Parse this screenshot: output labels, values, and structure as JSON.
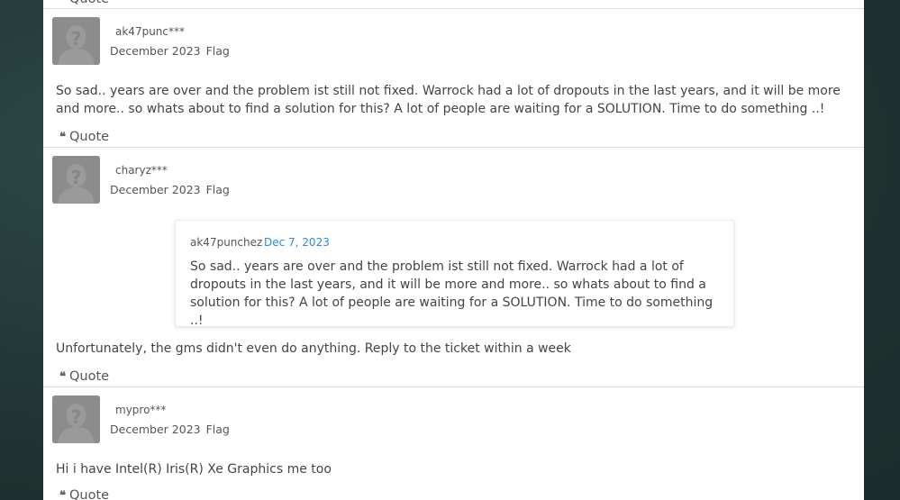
{
  "quote_label": "Quote",
  "flag_label": "Flag",
  "comments": [
    {
      "username": "ak47punc***",
      "date": "December 2023",
      "body": "So sad.. years are over and the problem ist still not fixed. Warrock had a lot of dropouts in the last years, and it will be more and more.. so whats about to find a solution for this? A lot of people are waiting for a SOLUTION. Time to do something ..!"
    },
    {
      "username": "charyz***",
      "date": "December 2023",
      "quote": {
        "author": "ak47punchez",
        "date": "Dec 7, 2023",
        "text": "So sad.. years are over and the problem ist still not fixed. Warrock had a lot of dropouts in the last years, and it will be more and more.. so whats about to find a solution for this? A lot of people are waiting for a SOLUTION. Time to do something ..!"
      },
      "body": "Unfortunately, the gms didn't even do anything. Reply to the ticket within a week"
    },
    {
      "username": "mypro***",
      "date": "December 2023",
      "body": "Hi i have Intel(R) Iris(R) Xe Graphics me too"
    }
  ],
  "colors": {
    "background": "#1f3332",
    "panel": "#ffffff",
    "link": "#2a8ad4",
    "avatar": "#8a8a8a"
  }
}
